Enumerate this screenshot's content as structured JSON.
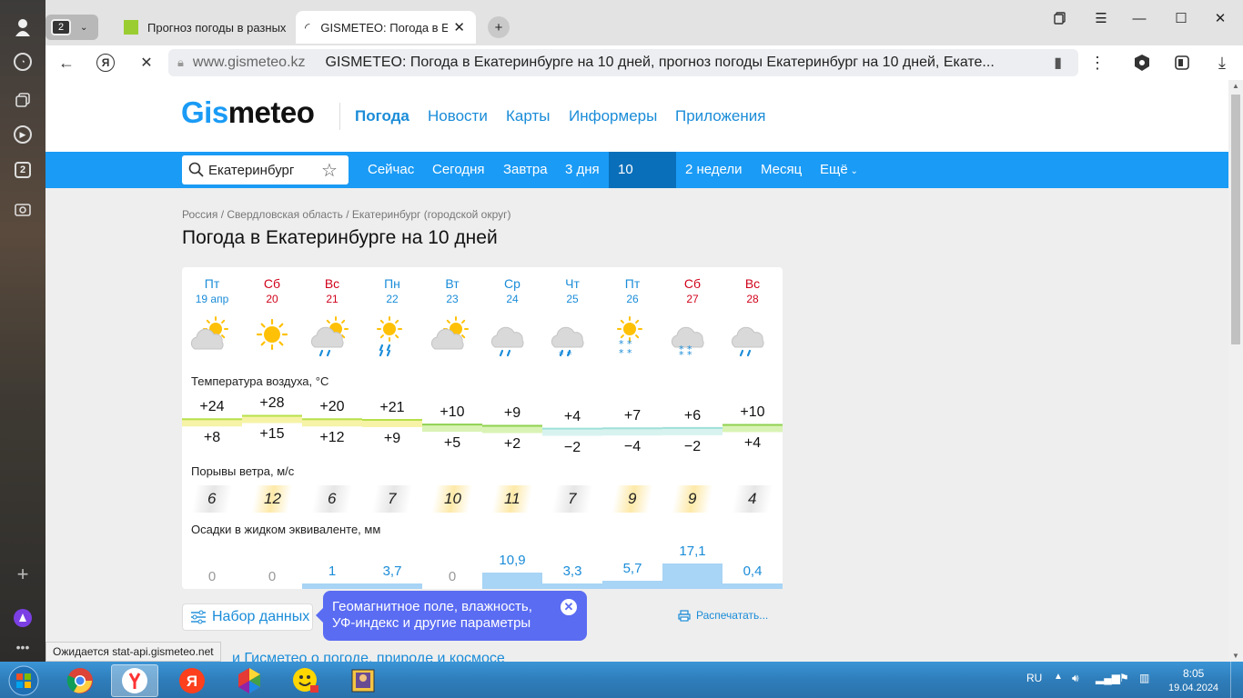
{
  "tabs": {
    "count": "2",
    "tab1_title": "Прогноз погоды в разных",
    "tab2_title": "GISMETEO: Погода в Ек"
  },
  "address": {
    "domain": "www.gismeteo.kz",
    "title": "GISMETEO: Погода в Екатеринбурге на 10 дней, прогноз погоды Екатеринбург на 10 дней, Екате..."
  },
  "site": {
    "logo_part1": "Gis",
    "logo_part2": "meteo",
    "top_nav": [
      "Погода",
      "Новости",
      "Карты",
      "Информеры",
      "Приложения"
    ],
    "search_value": "Екатеринбург",
    "blue_nav": [
      "Сейчас",
      "Сегодня",
      "Завтра",
      "3 дня",
      "10 дней",
      "2 недели",
      "Месяц",
      "Ещё"
    ],
    "breadcrumb": [
      "Россия",
      "Свердловская область",
      "Екатеринбург (городской округ)"
    ],
    "page_title": "Погода в Екатеринбурге на 10 дней",
    "temp_label": "Температура воздуха, °C",
    "wind_label": "Порывы ветра, м/с",
    "prec_label": "Осадки в жидком эквиваленте, мм",
    "settings_btn": "Набор данных",
    "tooltip_text": "Геомагнитное поле, влажность, УФ-индекс и другие параметры",
    "print_label": "Распечатать...",
    "bottom_link": "и Гисметео о погоде, природе и космосе"
  },
  "days": [
    {
      "dow": "Пт",
      "date": "19 апр",
      "weekend": false,
      "icon": "partly-cloudy",
      "tmax": "+24",
      "tmin": "+8",
      "tmaxv": 24,
      "tminv": 8,
      "wind": "6",
      "windHi": false,
      "prec": "0",
      "precv": 0
    },
    {
      "dow": "Сб",
      "date": "20",
      "weekend": true,
      "icon": "sunny",
      "tmax": "+28",
      "tmin": "+15",
      "tmaxv": 28,
      "tminv": 15,
      "wind": "12",
      "windHi": true,
      "prec": "0",
      "precv": 0
    },
    {
      "dow": "Вс",
      "date": "21",
      "weekend": true,
      "icon": "partly-cloudy-rain",
      "tmax": "+20",
      "tmin": "+12",
      "tmaxv": 20,
      "tminv": 12,
      "wind": "6",
      "windHi": false,
      "prec": "1",
      "precv": 1
    },
    {
      "dow": "Пн",
      "date": "22",
      "weekend": false,
      "icon": "sun-rain",
      "tmax": "+21",
      "tmin": "+9",
      "tmaxv": 21,
      "tminv": 9,
      "wind": "7",
      "windHi": false,
      "prec": "3,7",
      "precv": 3.7
    },
    {
      "dow": "Вт",
      "date": "23",
      "weekend": false,
      "icon": "partly-cloudy",
      "tmax": "+10",
      "tmin": "+5",
      "tmaxv": 10,
      "tminv": 5,
      "wind": "10",
      "windHi": true,
      "prec": "0",
      "precv": 0
    },
    {
      "dow": "Ср",
      "date": "24",
      "weekend": false,
      "icon": "cloud-rain",
      "tmax": "+9",
      "tmin": "+2",
      "tmaxv": 9,
      "tminv": 2,
      "wind": "11",
      "windHi": true,
      "prec": "10,9",
      "precv": 10.9
    },
    {
      "dow": "Чт",
      "date": "25",
      "weekend": false,
      "icon": "cloud-sleet",
      "tmax": "+4",
      "tmin": "−2",
      "tmaxv": 4,
      "tminv": -2,
      "wind": "7",
      "windHi": false,
      "prec": "3,3",
      "precv": 3.3
    },
    {
      "dow": "Пт",
      "date": "26",
      "weekend": false,
      "icon": "sun-snow",
      "tmax": "+7",
      "tmin": "−4",
      "tmaxv": 7,
      "tminv": -4,
      "wind": "9",
      "windHi": true,
      "prec": "5,7",
      "precv": 5.7
    },
    {
      "dow": "Сб",
      "date": "27",
      "weekend": true,
      "icon": "cloud-snow",
      "tmax": "+6",
      "tmin": "−2",
      "tmaxv": 6,
      "tminv": -2,
      "wind": "9",
      "windHi": true,
      "prec": "17,1",
      "precv": 17.1
    },
    {
      "dow": "Вс",
      "date": "28",
      "weekend": true,
      "icon": "cloud-rain",
      "tmax": "+10",
      "tmin": "+4",
      "tmaxv": 10,
      "tminv": 4,
      "wind": "4",
      "windHi": false,
      "prec": "0,4",
      "precv": 0.4
    }
  ],
  "status_text": "Ожидается stat-api.gismeteo.net",
  "tray": {
    "lang": "RU",
    "time": "8:05",
    "date": "19.04.2024"
  },
  "colors": {
    "brand_blue": "#1a9bf5",
    "active_nav": "#0a6fba",
    "tooltip": "#5a6cf2",
    "weekend_red": "#d0021b"
  }
}
